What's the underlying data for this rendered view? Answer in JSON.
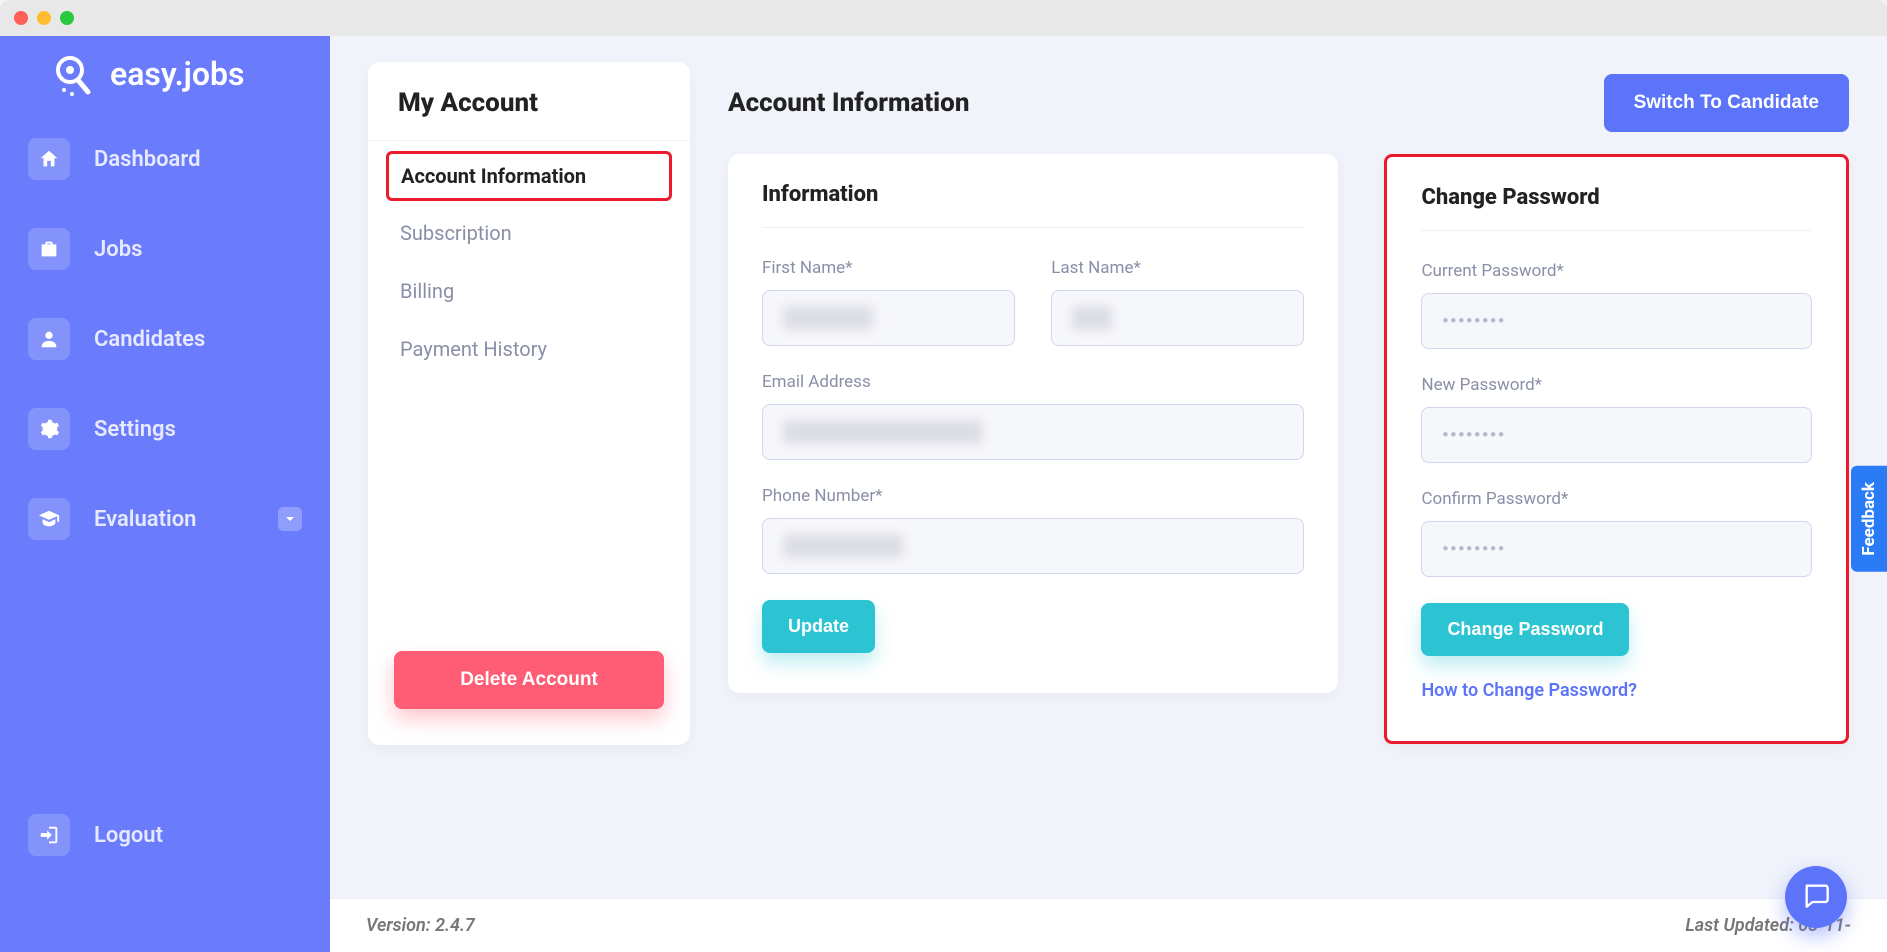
{
  "brand": {
    "name": "easy.jobs"
  },
  "sidebar": {
    "items": [
      {
        "label": "Dashboard",
        "icon": "home"
      },
      {
        "label": "Jobs",
        "icon": "briefcase"
      },
      {
        "label": "Candidates",
        "icon": "user"
      },
      {
        "label": "Settings",
        "icon": "gear"
      },
      {
        "label": "Evaluation",
        "icon": "graduation",
        "has_submenu": true
      }
    ],
    "logout_label": "Logout"
  },
  "account_card": {
    "title": "My Account",
    "menu": [
      "Account Information",
      "Subscription",
      "Billing",
      "Payment History"
    ],
    "delete_label": "Delete Account"
  },
  "page": {
    "title": "Account Information",
    "switch_label": "Switch To Candidate"
  },
  "info_panel": {
    "title": "Information",
    "first_name_label": "First Name*",
    "last_name_label": "Last Name*",
    "email_label": "Email Address",
    "phone_label": "Phone Number*",
    "update_label": "Update"
  },
  "pw_panel": {
    "title": "Change Password",
    "current_label": "Current Password*",
    "new_label": "New Password*",
    "confirm_label": "Confirm Password*",
    "placeholder": "••••••••",
    "change_label": "Change Password",
    "howto_label": "How to Change Password?"
  },
  "footer": {
    "version_text": "Version: 2.4.7",
    "updated_text": "Last Updated: 03-11-"
  },
  "feedback": {
    "label": "Feedback"
  }
}
